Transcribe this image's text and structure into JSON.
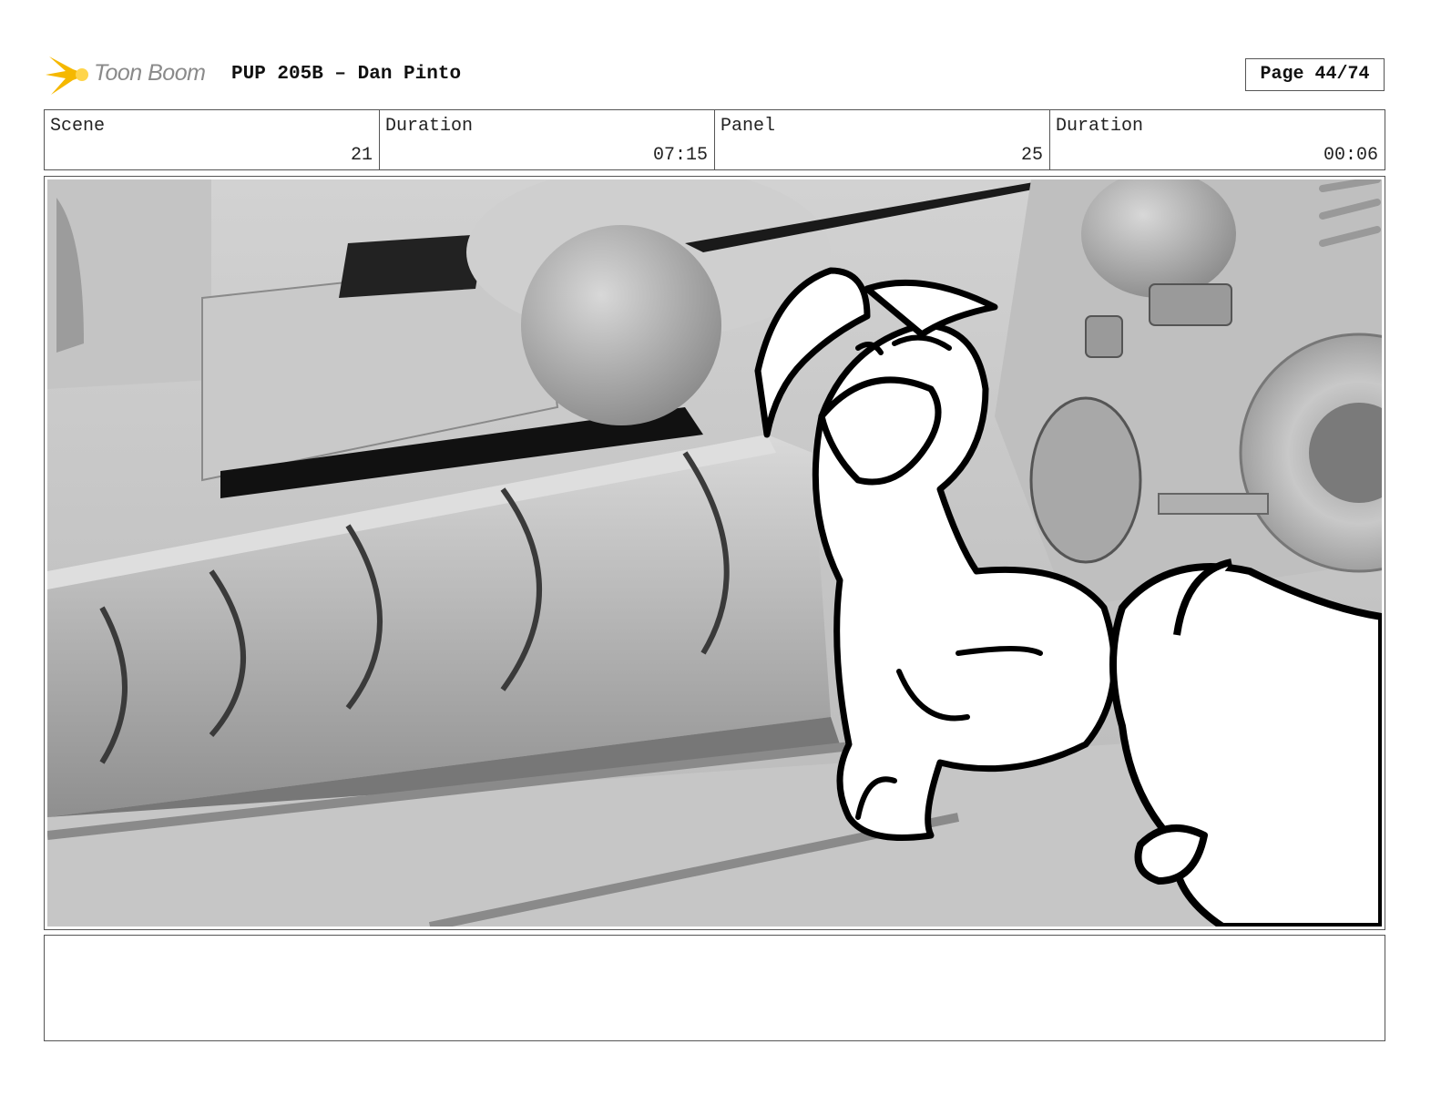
{
  "header": {
    "logo_text": "Toon Boom",
    "title": "PUP 205B – Dan Pinto",
    "page": "Page 44/74"
  },
  "info": {
    "scene_label": "Scene",
    "scene_value": "21",
    "scene_duration_label": "Duration",
    "scene_duration_value": "07:15",
    "panel_label": "Panel",
    "panel_value": "25",
    "panel_duration_label": "Duration",
    "panel_duration_value": "00:06"
  },
  "colors": {
    "logo_accent": "#f5b800",
    "border": "#555555",
    "background_gray": "#bdbdbd"
  }
}
